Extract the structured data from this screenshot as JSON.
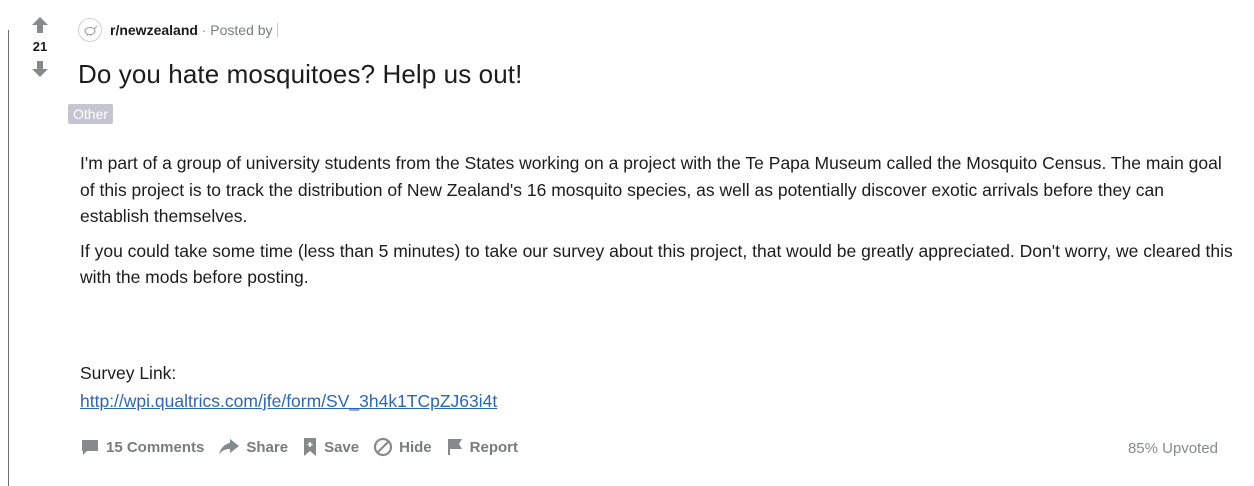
{
  "vote": {
    "score": "21",
    "upvote_icon": "arrow-up-icon",
    "downvote_icon": "arrow-down-icon"
  },
  "post": {
    "subreddit": "r/newzealand",
    "separator": "·",
    "posted_by": "Posted by",
    "title": "Do you hate mosquitoes? Help us out!",
    "flair": "Other",
    "flair_color": "#c5c5d1",
    "body_paragraphs": [
      "I'm part of a group of university students from the States working on a project with the Te Papa Museum called the Mosquito Census. The main goal of this project is to track the distribution of New Zealand's 16 mosquito species, as well as potentially discover exotic arrivals before they can establish themselves.",
      "If you could take some time (less than 5 minutes) to take our survey about this project, that would be greatly appreciated. Don't worry, we cleared this with the mods before posting."
    ],
    "survey_label": "Survey Link:",
    "survey_url": "http://wpi.qualtrics.com/jfe/form/SV_3h4k1TCpZJ63i4t"
  },
  "actions": {
    "comments": "15 Comments",
    "share": "Share",
    "save": "Save",
    "hide": "Hide",
    "report": "Report"
  },
  "upvoted": "85% Upvoted",
  "colors": {
    "text": "#1c1c1c",
    "muted": "#787c7e",
    "link": "#2f66b0"
  }
}
